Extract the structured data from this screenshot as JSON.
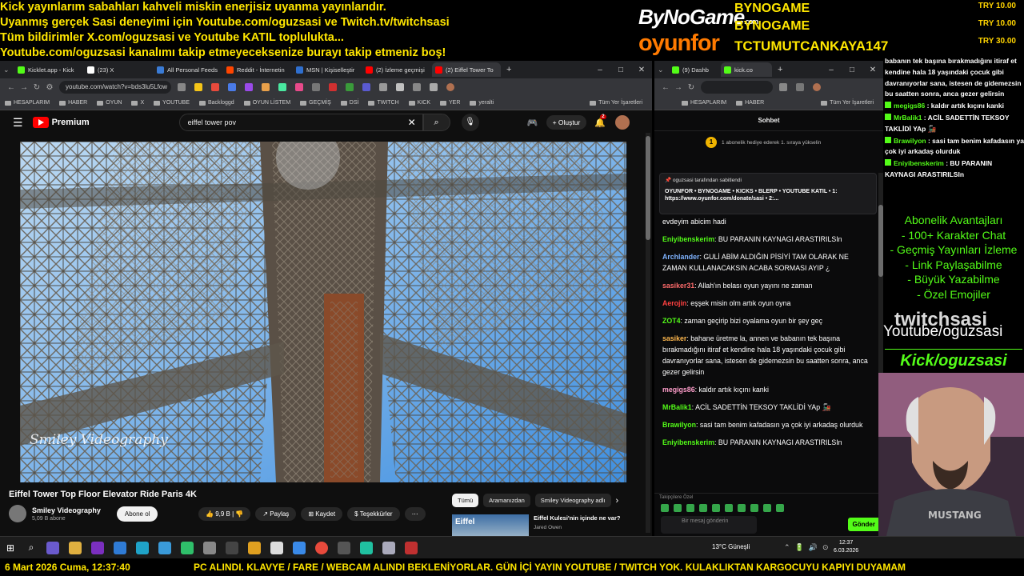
{
  "overlay": {
    "top_lines": [
      "Kick yayınlarım sabahları kahveli miskin enerjisiz uyanma yayınlarıdır.",
      "Uyanmış gerçek Sasi deneyimi için Youtube.com/oguzsasi ve Twitch.tv/twitchsasi",
      "Tüm bildirimler X.com/oguzsasi ve Youtube KATIL toplulukta...",
      "Youtube.com/oguzsasi kanalımı takip etmeyeceksenize burayı takip etmeniz boş!"
    ],
    "brand_bynogame": "ByNoGame",
    "brand_com": ".com",
    "brand_oyunfor": "oyunfor",
    "donors": [
      "BYNOGAME",
      "BYNOGAME",
      "TCTUMUTCANKAYA147"
    ],
    "amounts": [
      "TRY 10.00",
      "TRY 10.00",
      "TRY 30.00"
    ],
    "side_chat": [
      {
        "user": "",
        "text": "babanın tek başına bırakmadığını itiraf et kendine hala 18 yaşındaki çocuk gibi davranıyorlar sana, istesen de gidemezsin bu saatten sonra, anca gezer gelirsin"
      },
      {
        "user": "megigs86",
        "text": " : kaldır artık kıçını kanki"
      },
      {
        "user": "MrBalik1",
        "text": " : ACİL SADETTİN TEKSOY TAKLİDİ YAp 🚂"
      },
      {
        "user": "Brawilyon",
        "text": " : sasi tam benim kafadasın ya çok iyi arkadaş olurduk"
      },
      {
        "user": "Eniyibenskerim",
        "text": " : BU PARANIN KAYNAGI ARASTIRILSIn"
      }
    ],
    "perks": [
      "Abonelik Avantajları",
      "- 100+ Karakter Chat",
      "- Geçmiş Yayınları İzleme",
      "- Link Paylaşabilme",
      "- Büyük Yazabilme",
      "- Özel Emojiler"
    ],
    "twitch": "twitchsasi",
    "youtube": "Youtube/oguzsasi",
    "kick": "Kick/oguzsasi",
    "date": "6 Mart 2026 Cuma, 12:37:40",
    "ticker": "PC ALINDI. KLAVYE / FARE / WEBCAM ALINDI BEKLENİYORLAR. GÜN İÇİ YAYIN YOUTUBE / TWITCH YOK. KULAKLIKTAN KARGOCUYU KAPIYI DUYAMAM"
  },
  "left_browser": {
    "tabs": [
      "Kicklet.app - Kick",
      "(23) X",
      "All Personal Feeds",
      "Reddit - İnternetin",
      "MSN | Kişiselleştir",
      "(2) İzleme geçmişi",
      "(2) Eiffel Tower To"
    ],
    "tab_colors": [
      "#53fc18",
      "#ffffff",
      "#3a7bd5",
      "#ff4500",
      "#2f6fce",
      "#ff0000",
      "#ff0000"
    ],
    "url": "youtube.com/watch?v=bds3lu5Lfow",
    "bookmarks": [
      "HESAPLARIM",
      "HABER",
      "OYUN",
      "X",
      "YOUTUBE",
      "Backloggd",
      "OYUN LİSTEM",
      "GEÇMİŞ",
      "DSİ",
      "TWITCH",
      "KICK",
      "YER",
      "yeralti",
      "Tüm Yer İşaretleri"
    ]
  },
  "youtube": {
    "premium": "Premium",
    "search_value": "eiffel tower pov",
    "create": "Oluştur",
    "notif_count": "2",
    "watermark": "Smiley Videography",
    "video_title": "Eiffel Tower Top Floor Elevator Ride Paris 4K",
    "channel": "Smiley Videography",
    "subs": "5,09 B abone",
    "subscribe": "Abone ol",
    "likes": "9,9 B",
    "share": "Paylaş",
    "save": "Kaydet",
    "thanks": "Teşekkürler",
    "chips": [
      "Tümü",
      "Aramanızdan",
      "Smiley Videography adlı"
    ],
    "reco_thumb": "Eiffel",
    "reco_title": "Eiffel Kulesi'nin içinde ne var?",
    "reco_author": "Jared Owen"
  },
  "right_browser": {
    "tabs": [
      "(9) Dashb",
      "kick.co"
    ],
    "tab_colors": [
      "#53fc18",
      "#53fc18"
    ],
    "bookmarks": [
      "HESAPLARIM",
      "HABER",
      "Tüm Yer İşaretleri"
    ]
  },
  "kick_chat": {
    "header": "Sohbet",
    "gift_count": "1",
    "gift_text": "1 abonelik hediye ederek 1. sıraya yükselin",
    "pin_by": "oguzsasi tarafından sabitlendi",
    "pin_text": "OYUNFOR • BYNOGAME • KICKS • BLERP • YOUTUBE KATIL • 1: https://www.oyunfor.com/donate/sasi • 2:...",
    "messages": [
      {
        "user": "",
        "color": "#ffffff",
        "text": "evdeyim abicim hadi"
      },
      {
        "user": "Eniyibenskerim",
        "color": "#53fc18",
        "text": ": BU PARANIN KAYNAGI ARASTIRILSIn"
      },
      {
        "user": "Archlander",
        "color": "#7fb3ff",
        "text": ": GULİ ABİM ALDIĞIN PİSİYİ TAM OLARAK NE ZAMAN KULLANACAKSIN ACABA SORMASI AYIP ¿"
      },
      {
        "user": "sasiker31",
        "color": "#ff6b6b",
        "text": ": Allah'ın belası oyun yayını ne zaman"
      },
      {
        "user": "Aerojin",
        "color": "#ff4040",
        "text": ": eşşek misin olm artık oyun oyna"
      },
      {
        "user": "ZOT4",
        "color": "#53fc18",
        "text": ": zaman geçirip bizi oyalama oyun bir şey geç"
      },
      {
        "user": "sasiker",
        "color": "#ffb84d",
        "text": ": bahane üretme la, annen ve babanın tek başına bırakmadığını itiraf et kendine hala 18 yaşındaki çocuk gibi davranıyorlar sana, istesen de gidemezsin bu saatten sonra, anca gezer gelirsin"
      },
      {
        "user": "megigs86",
        "color": "#ff9ecb",
        "text": ": kaldır artık kıçını kanki"
      },
      {
        "user": "MrBalik1",
        "color": "#53fc18",
        "text": ": ACİL SADETTİN TEKSOY TAKLİDİ YAp 🚂"
      },
      {
        "user": "Brawilyon",
        "color": "#53fc18",
        "text": ": sasi tam benim kafadasın ya çok iyi arkadaş olurduk"
      },
      {
        "user": "Eniyibenskerim",
        "color": "#53fc18",
        "text": ": BU PARANIN KAYNAGI ARASTIRILSIn"
      }
    ],
    "emote_label": "Takipçilere Özel",
    "input_placeholder": "Bir mesaj gönderin",
    "send": "Gönder"
  },
  "taskbar": {
    "weather": "13°C  Güneşli",
    "time": "12:37",
    "date": "6.03.2026"
  }
}
